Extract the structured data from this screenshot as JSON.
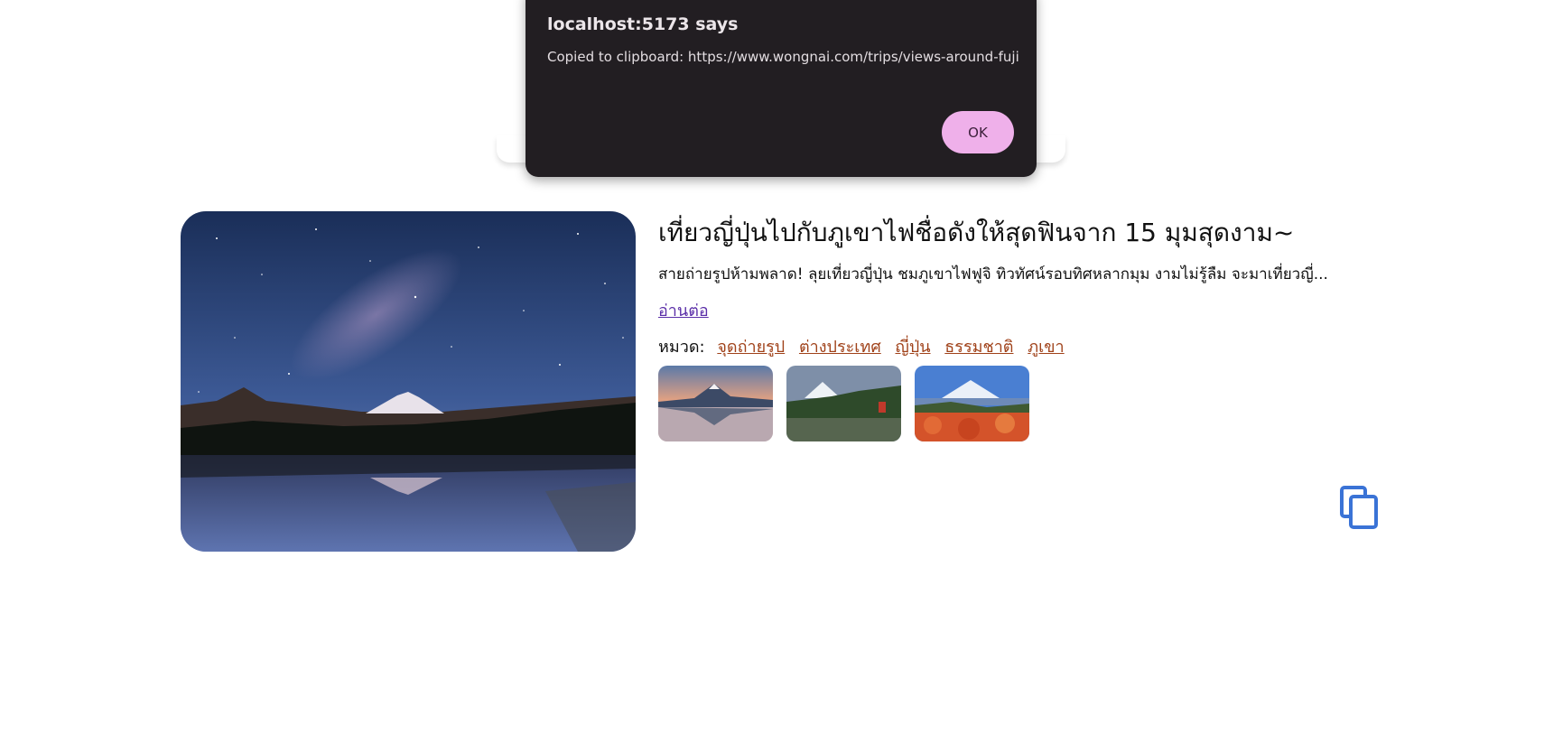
{
  "dialog": {
    "title": "localhost:5173 says",
    "message": "Copied to clipboard: https://www.wongnai.com/trips/views-around-fuji",
    "ok_label": "OK"
  },
  "article": {
    "title": "เที่ยวญี่ปุ่นไปกับภูเขาไฟชื่อดังให้สุดฟินจาก 15 มุมสุดงาม~",
    "description": "สายถ่ายรูปห้ามพลาด! ลุยเที่ยวญี่ปุ่น ชมภูเขาไฟฟูจิ ทิวทัศน์รอบทิศหลากมุม งามไม่รู้ลืม จะมาเที่ยวญี่...",
    "read_more": "อ่านต่อ",
    "category_label": "หมวด:",
    "categories": [
      "จุดถ่ายรูป",
      "ต่างประเทศ",
      "ญี่ปุ่น",
      "ธรรมชาติ",
      "ภูเขา"
    ]
  },
  "icons": {
    "copy": "copy-icon"
  },
  "colors": {
    "dialog_bg": "#221e22",
    "ok_button": "#efb0ea",
    "category_link": "#a0421a",
    "read_more_link": "#5b2fa8",
    "copy_icon": "#3a73d6"
  }
}
